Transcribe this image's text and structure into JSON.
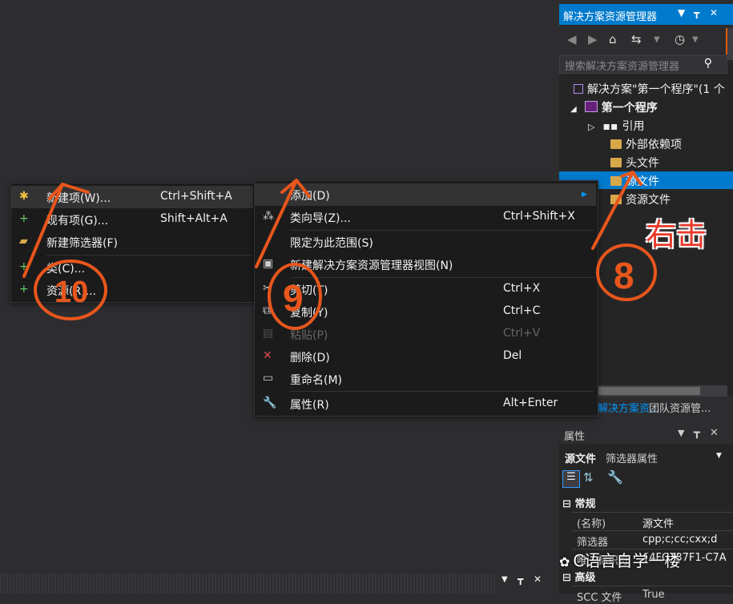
{
  "solution_explorer": {
    "title": "解决方案资源管理器",
    "title_buttons": [
      "▼",
      "┳",
      "✕"
    ],
    "search_placeholder": "搜索解决方案资源管理器",
    "tree": [
      {
        "label": "解决方案\"第一个程序\"(1 个",
        "icon": "solution-icon"
      },
      {
        "label": "第一个程序",
        "icon": "project-icon",
        "bold": true,
        "expanded": true
      },
      {
        "label": "引用",
        "icon": "references-icon",
        "collapsed": true
      },
      {
        "label": "外部依赖项",
        "icon": "folder-icon"
      },
      {
        "label": "头文件",
        "icon": "folder-icon"
      },
      {
        "label": "源文件",
        "icon": "folder-icon",
        "selected": true
      },
      {
        "label": "资源文件",
        "icon": "folder-icon"
      }
    ],
    "tabs": [
      "解决方案资...",
      "团队资源管..."
    ]
  },
  "properties": {
    "title": "属性",
    "object_name": "源文件",
    "object_type": "筛选器属性",
    "groups": [
      {
        "name": "常规",
        "rows": [
          {
            "key": "(名称)",
            "value": "源文件"
          },
          {
            "key": "筛选器",
            "value": "cpp;c;cc;cxx;d"
          },
          {
            "key": "唯一标识符",
            "value": "{4FC737F1-C7A"
          }
        ]
      },
      {
        "name": "高级",
        "rows": [
          {
            "key": "SCC 文件",
            "value": "True"
          }
        ]
      }
    ]
  },
  "context_menu": {
    "items": [
      {
        "label": "添加(D)",
        "shortcut": "",
        "submenu": true,
        "icon": ""
      },
      {
        "label": "类向导(Z)...",
        "shortcut": "Ctrl+Shift+X",
        "icon": "class-wizard-icon"
      },
      {
        "label": "限定为此范围(S)",
        "shortcut": "",
        "icon": ""
      },
      {
        "label": "新建解决方案资源管理器视图(N)",
        "shortcut": "",
        "icon": "new-view-icon"
      },
      {
        "label": "剪切(T)",
        "shortcut": "Ctrl+X",
        "icon": "cut-icon"
      },
      {
        "label": "复制(Y)",
        "shortcut": "Ctrl+C",
        "icon": "copy-icon"
      },
      {
        "label": "粘贴(P)",
        "shortcut": "Ctrl+V",
        "icon": "paste-icon",
        "disabled": true
      },
      {
        "label": "删除(D)",
        "shortcut": "Del",
        "icon": "delete-icon"
      },
      {
        "label": "重命名(M)",
        "shortcut": "",
        "icon": "rename-icon"
      },
      {
        "label": "属性(R)",
        "shortcut": "Alt+Enter",
        "icon": "wrench-icon"
      }
    ]
  },
  "add_submenu": {
    "items": [
      {
        "label": "新建项(W)...",
        "shortcut": "Ctrl+Shift+A",
        "icon": "new-item-icon"
      },
      {
        "label": "现有项(G)...",
        "shortcut": "Shift+Alt+A",
        "icon": "existing-item-icon"
      },
      {
        "label": "新建筛选器(F)",
        "shortcut": "",
        "icon": "new-filter-icon"
      },
      {
        "label": "类(C)...",
        "shortcut": "",
        "icon": "class-icon"
      },
      {
        "label": "资源(R)...",
        "shortcut": "",
        "icon": "resource-icon"
      }
    ]
  },
  "annotations": {
    "right_click_note": "右击",
    "step_numbers": [
      "8",
      "9",
      "10"
    ]
  },
  "watermark": "C语言自学一楼",
  "colors": {
    "accent": "#007acc",
    "annotation": "#e8561c",
    "menu_bg": "#1b1b1c",
    "ide_bg": "#2d2d30"
  }
}
